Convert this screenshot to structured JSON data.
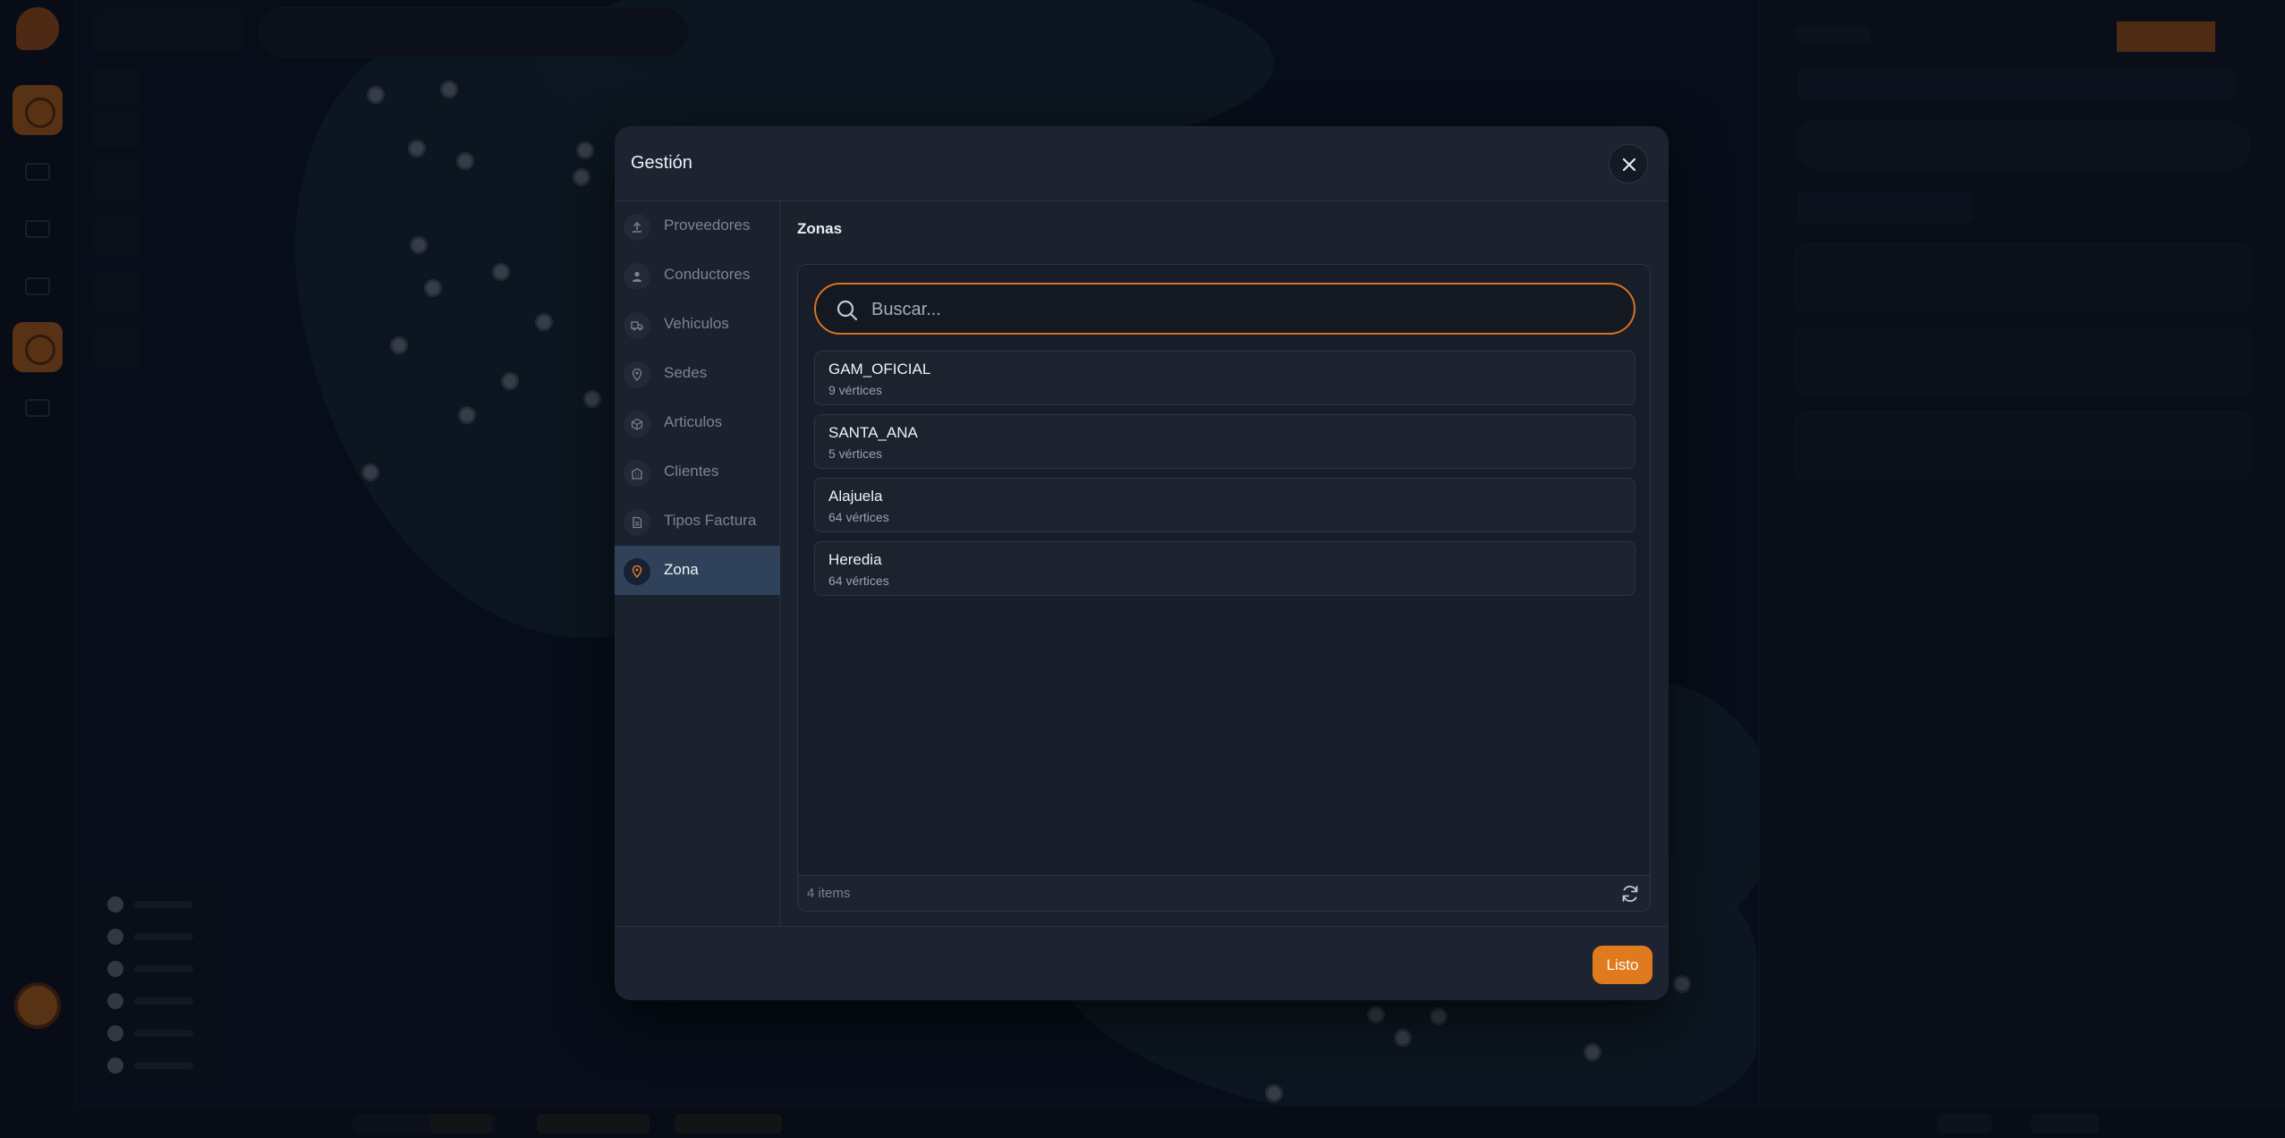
{
  "modal": {
    "title": "Gestión",
    "nav": [
      {
        "label": "Proveedores",
        "icon": "upload-icon",
        "active": false
      },
      {
        "label": "Conductores",
        "icon": "user-icon",
        "active": false
      },
      {
        "label": "Vehiculos",
        "icon": "truck-icon",
        "active": false
      },
      {
        "label": "Sedes",
        "icon": "location-pin-icon",
        "active": false
      },
      {
        "label": "Articulos",
        "icon": "box-icon",
        "active": false
      },
      {
        "label": "Clientes",
        "icon": "building-icon",
        "active": false
      },
      {
        "label": "Tipos Factura",
        "icon": "document-icon",
        "active": false
      },
      {
        "label": "Zona",
        "icon": "location-pin-icon",
        "active": true
      }
    ],
    "section_title": "Zonas",
    "search": {
      "placeholder": "Buscar..."
    },
    "zones": [
      {
        "name": "GAM_OFICIAL",
        "vertices": "9 vértices"
      },
      {
        "name": "SANTA_ANA",
        "vertices": "5 vértices"
      },
      {
        "name": "Alajuela",
        "vertices": "64 vértices"
      },
      {
        "name": "Heredia",
        "vertices": "64 vértices"
      }
    ],
    "item_count": "4 items",
    "done_label": "Listo"
  },
  "colors": {
    "accent": "#e07a1f",
    "modal_bg": "#1b212d",
    "active_nav": "#2f4259"
  }
}
